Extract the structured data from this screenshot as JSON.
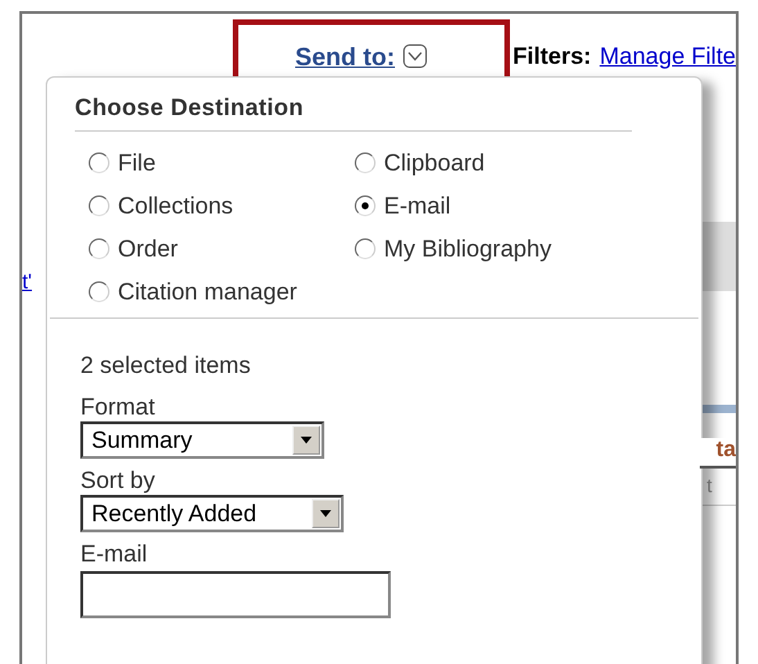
{
  "send_to": {
    "label": "Send to:"
  },
  "filters": {
    "label": "Filters:",
    "link": "Manage Filte"
  },
  "background": {
    "left_link": "t'",
    "right_heading": "ta",
    "right_text": "t"
  },
  "popup": {
    "title": "Choose Destination",
    "destinations": [
      {
        "label": "File",
        "selected": false
      },
      {
        "label": "Clipboard",
        "selected": false
      },
      {
        "label": "Collections",
        "selected": false
      },
      {
        "label": "E-mail",
        "selected": true
      },
      {
        "label": "Order",
        "selected": false
      },
      {
        "label": "My Bibliography",
        "selected": false
      },
      {
        "label": "Citation manager",
        "selected": false
      }
    ],
    "selection_count": "2 selected items",
    "format": {
      "label": "Format",
      "value": "Summary"
    },
    "sort": {
      "label": "Sort by",
      "value": "Recently Added"
    },
    "email": {
      "label": "E-mail"
    }
  }
}
